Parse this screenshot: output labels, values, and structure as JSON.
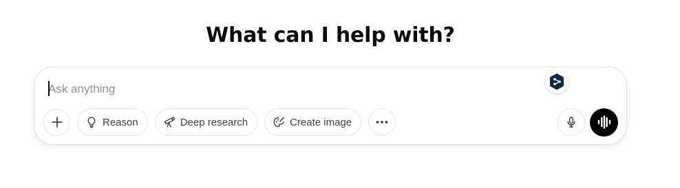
{
  "heading": "What can I help with?",
  "composer": {
    "placeholder": "Ask anything",
    "value": ""
  },
  "extension_badge_icon": "deepl-icon",
  "toolbar": {
    "attach_icon": "plus-icon",
    "buttons": [
      {
        "label": "Reason",
        "icon": "lightbulb-icon"
      },
      {
        "label": "Deep research",
        "icon": "telescope-icon"
      },
      {
        "label": "Create image",
        "icon": "paint-palette-icon"
      }
    ],
    "more_icon": "ellipsis-icon",
    "mic_icon": "microphone-icon",
    "voice_icon": "voice-waveform-icon"
  },
  "colors": {
    "voice_button_bg": "#000000",
    "badge_bg": "#0f2b46",
    "border": "#e3e3e3",
    "placeholder": "#8f8f8f"
  }
}
